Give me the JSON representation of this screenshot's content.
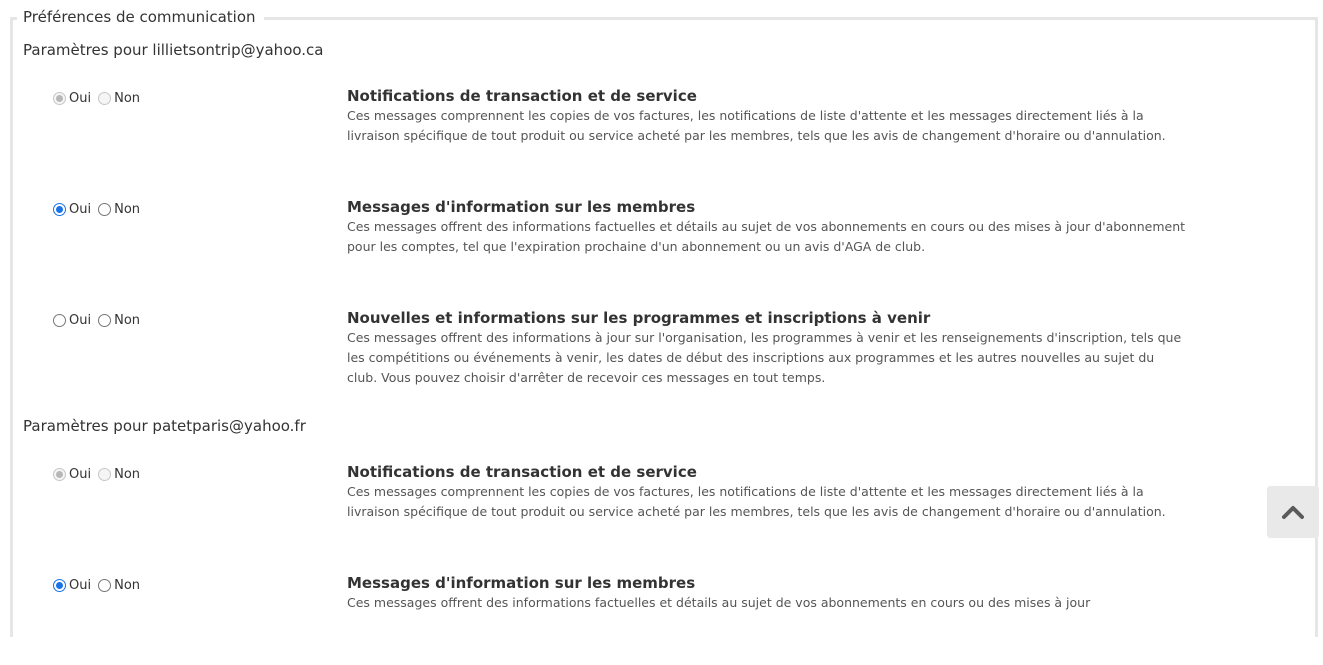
{
  "legend": "Préférences de communication",
  "radio_yes": "Oui",
  "radio_no": "Non",
  "accounts": [
    {
      "settings_label": "Paramètres pour lillietsontrip@yahoo.ca",
      "prefs": [
        {
          "title": "Notifications de transaction et de service",
          "desc": "Ces messages comprennent les copies de vos factures, les notifications de liste d'attente et les messages directement liés à la livraison spécifique de tout produit ou service acheté par les membres, tels que les avis de changement d'horaire ou d'annulation.",
          "selected": "oui",
          "disabled": true
        },
        {
          "title": "Messages d'information sur les membres",
          "desc": "Ces messages offrent des informations factuelles et détails au sujet de vos abonnements en cours ou des mises à jour d'abonnement pour les comptes, tel que l'expiration prochaine d'un abonnement ou un avis d'AGA de club.",
          "selected": "oui",
          "disabled": false
        },
        {
          "title": "Nouvelles et informations sur les programmes et inscriptions à venir",
          "desc": "Ces messages offrent des informations à jour sur l'organisation, les programmes à venir et les renseignements d'inscription, tels que les compétitions ou événements à venir, les dates de début des inscriptions aux programmes et les autres nouvelles au sujet du club. Vous pouvez choisir d'arrêter de recevoir ces messages en tout temps.",
          "selected": "none",
          "disabled": false
        }
      ]
    },
    {
      "settings_label": "Paramètres pour patetparis@yahoo.fr",
      "prefs": [
        {
          "title": "Notifications de transaction et de service",
          "desc": "Ces messages comprennent les copies de vos factures, les notifications de liste d'attente et les messages directement liés à la livraison spécifique de tout produit ou service acheté par les membres, tels que les avis de changement d'horaire ou d'annulation.",
          "selected": "oui",
          "disabled": true
        },
        {
          "title": "Messages d'information sur les membres",
          "desc": "Ces messages offrent des informations factuelles et détails au sujet de vos abonnements en cours ou des mises à jour",
          "selected": "oui",
          "disabled": false
        }
      ]
    }
  ],
  "scroll_top_icon": "chevron-up-icon"
}
